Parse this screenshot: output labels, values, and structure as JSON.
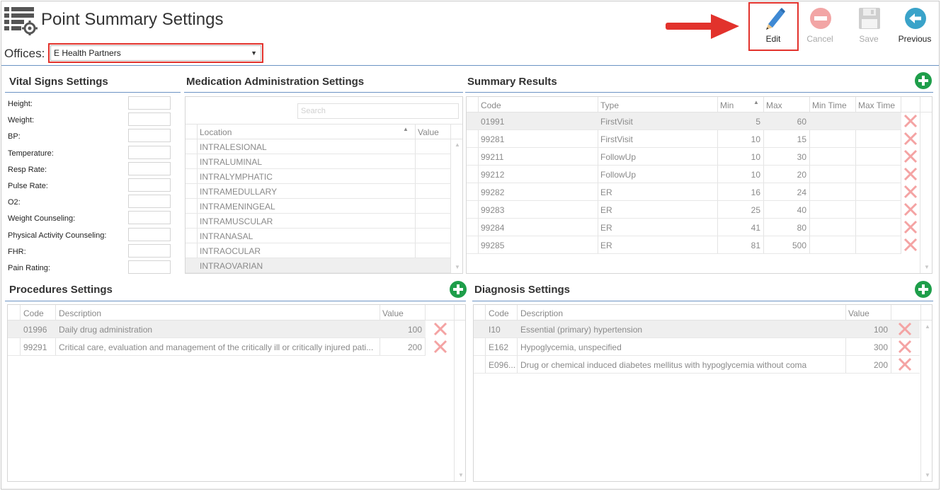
{
  "header": {
    "title": "Point Summary Settings",
    "offices_label": "Offices:",
    "office_value": "E Health Partners"
  },
  "toolbar": {
    "edit": "Edit",
    "cancel": "Cancel",
    "save": "Save",
    "previous": "Previous"
  },
  "colors": {
    "accent": "#6b93c4",
    "highlight": "#e2322c",
    "add": "#1e9e4a",
    "delete": "#f4a3a3"
  },
  "vital_signs": {
    "title": "Vital Signs Settings",
    "fields": [
      "Height:",
      "Weight:",
      "BP:",
      "Temperature:",
      "Resp Rate:",
      "Pulse Rate:",
      "O2:",
      "Weight Counseling:",
      "Physical Activity Counseling:",
      "FHR:",
      "Pain Rating:"
    ]
  },
  "medication": {
    "title": "Medication Administration Settings",
    "search_placeholder": "Search",
    "columns": [
      "Location",
      "Value"
    ],
    "rows": [
      "INTRALESIONAL",
      "INTRALUMINAL",
      "INTRALYMPHATIC",
      "INTRAMEDULLARY",
      "INTRAMENINGEAL",
      "INTRAMUSCULAR",
      "INTRANASAL",
      "INTRAOCULAR",
      "INTRAOVARIAN"
    ]
  },
  "summary": {
    "title": "Summary Results",
    "columns": [
      "Code",
      "Type",
      "Min",
      "Max",
      "Min Time",
      "Max Time"
    ],
    "rows": [
      {
        "code": "01991",
        "type": "FirstVisit",
        "min": "5",
        "max": "60"
      },
      {
        "code": "99281",
        "type": "FirstVisit",
        "min": "10",
        "max": "15"
      },
      {
        "code": "99211",
        "type": "FollowUp",
        "min": "10",
        "max": "30"
      },
      {
        "code": "99212",
        "type": "FollowUp",
        "min": "10",
        "max": "20"
      },
      {
        "code": "99282",
        "type": "ER",
        "min": "16",
        "max": "24"
      },
      {
        "code": "99283",
        "type": "ER",
        "min": "25",
        "max": "40"
      },
      {
        "code": "99284",
        "type": "ER",
        "min": "41",
        "max": "80"
      },
      {
        "code": "99285",
        "type": "ER",
        "min": "81",
        "max": "500"
      }
    ]
  },
  "procedures": {
    "title": "Procedures Settings",
    "columns": [
      "Code",
      "Description",
      "Value"
    ],
    "rows": [
      {
        "code": "01996",
        "description": "Daily drug administration",
        "value": "100"
      },
      {
        "code": "99291",
        "description": "Critical care, evaluation and management of the critically ill or critically injured pati...",
        "value": "200"
      }
    ]
  },
  "diagnosis": {
    "title": "Diagnosis Settings",
    "columns": [
      "Code",
      "Description",
      "Value"
    ],
    "rows": [
      {
        "code": "I10",
        "description": "Essential (primary) hypertension",
        "value": "100"
      },
      {
        "code": "E162",
        "description": "Hypoglycemia, unspecified",
        "value": "300"
      },
      {
        "code": "E096...",
        "description": "Drug or chemical induced diabetes mellitus with hypoglycemia without coma",
        "value": "200"
      }
    ]
  }
}
